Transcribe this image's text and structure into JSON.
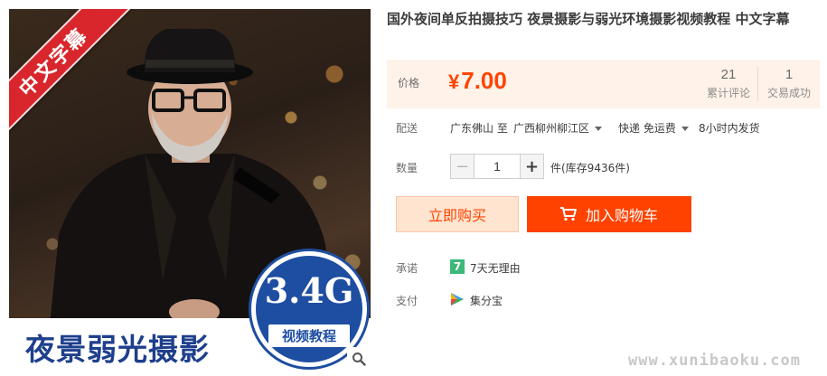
{
  "gallery": {
    "ribbon_text": "中文字幕",
    "banner_text": "夜景弱光摄影",
    "size_text": "3.4G",
    "badge_label": "视频教程",
    "zoom_icon": "search-icon"
  },
  "product": {
    "title": "国外夜间单反拍摄技巧 夜景摄影与弱光环境摄影视频教程 中文字幕"
  },
  "price": {
    "label": "价格",
    "currency": "¥",
    "value": "7.00",
    "reviews_count": "21",
    "reviews_label": "累计评论",
    "sales_count": "1",
    "sales_label": "交易成功"
  },
  "delivery": {
    "label": "配送",
    "route": "广东佛山 至",
    "destination": "广西柳州柳江区",
    "method": "快递 免运费",
    "ship_time": "8小时内发货"
  },
  "quantity": {
    "label": "数量",
    "value": "1",
    "unit_stock": "件(库存9436件)"
  },
  "actions": {
    "buy_now": "立即购买",
    "add_to_cart": "加入购物车"
  },
  "promise": {
    "label": "承诺",
    "icon_text": "7",
    "text": "7天无理由"
  },
  "payment": {
    "label": "支付",
    "text": "集分宝"
  },
  "watermark": "www.xunibaoku.com",
  "colors": {
    "accent": "#ff4200",
    "price": "#ff4400",
    "price_bg": "#fff2e8",
    "badge_blue": "#1e4ea1",
    "ribbon_red": "#d8262c"
  }
}
